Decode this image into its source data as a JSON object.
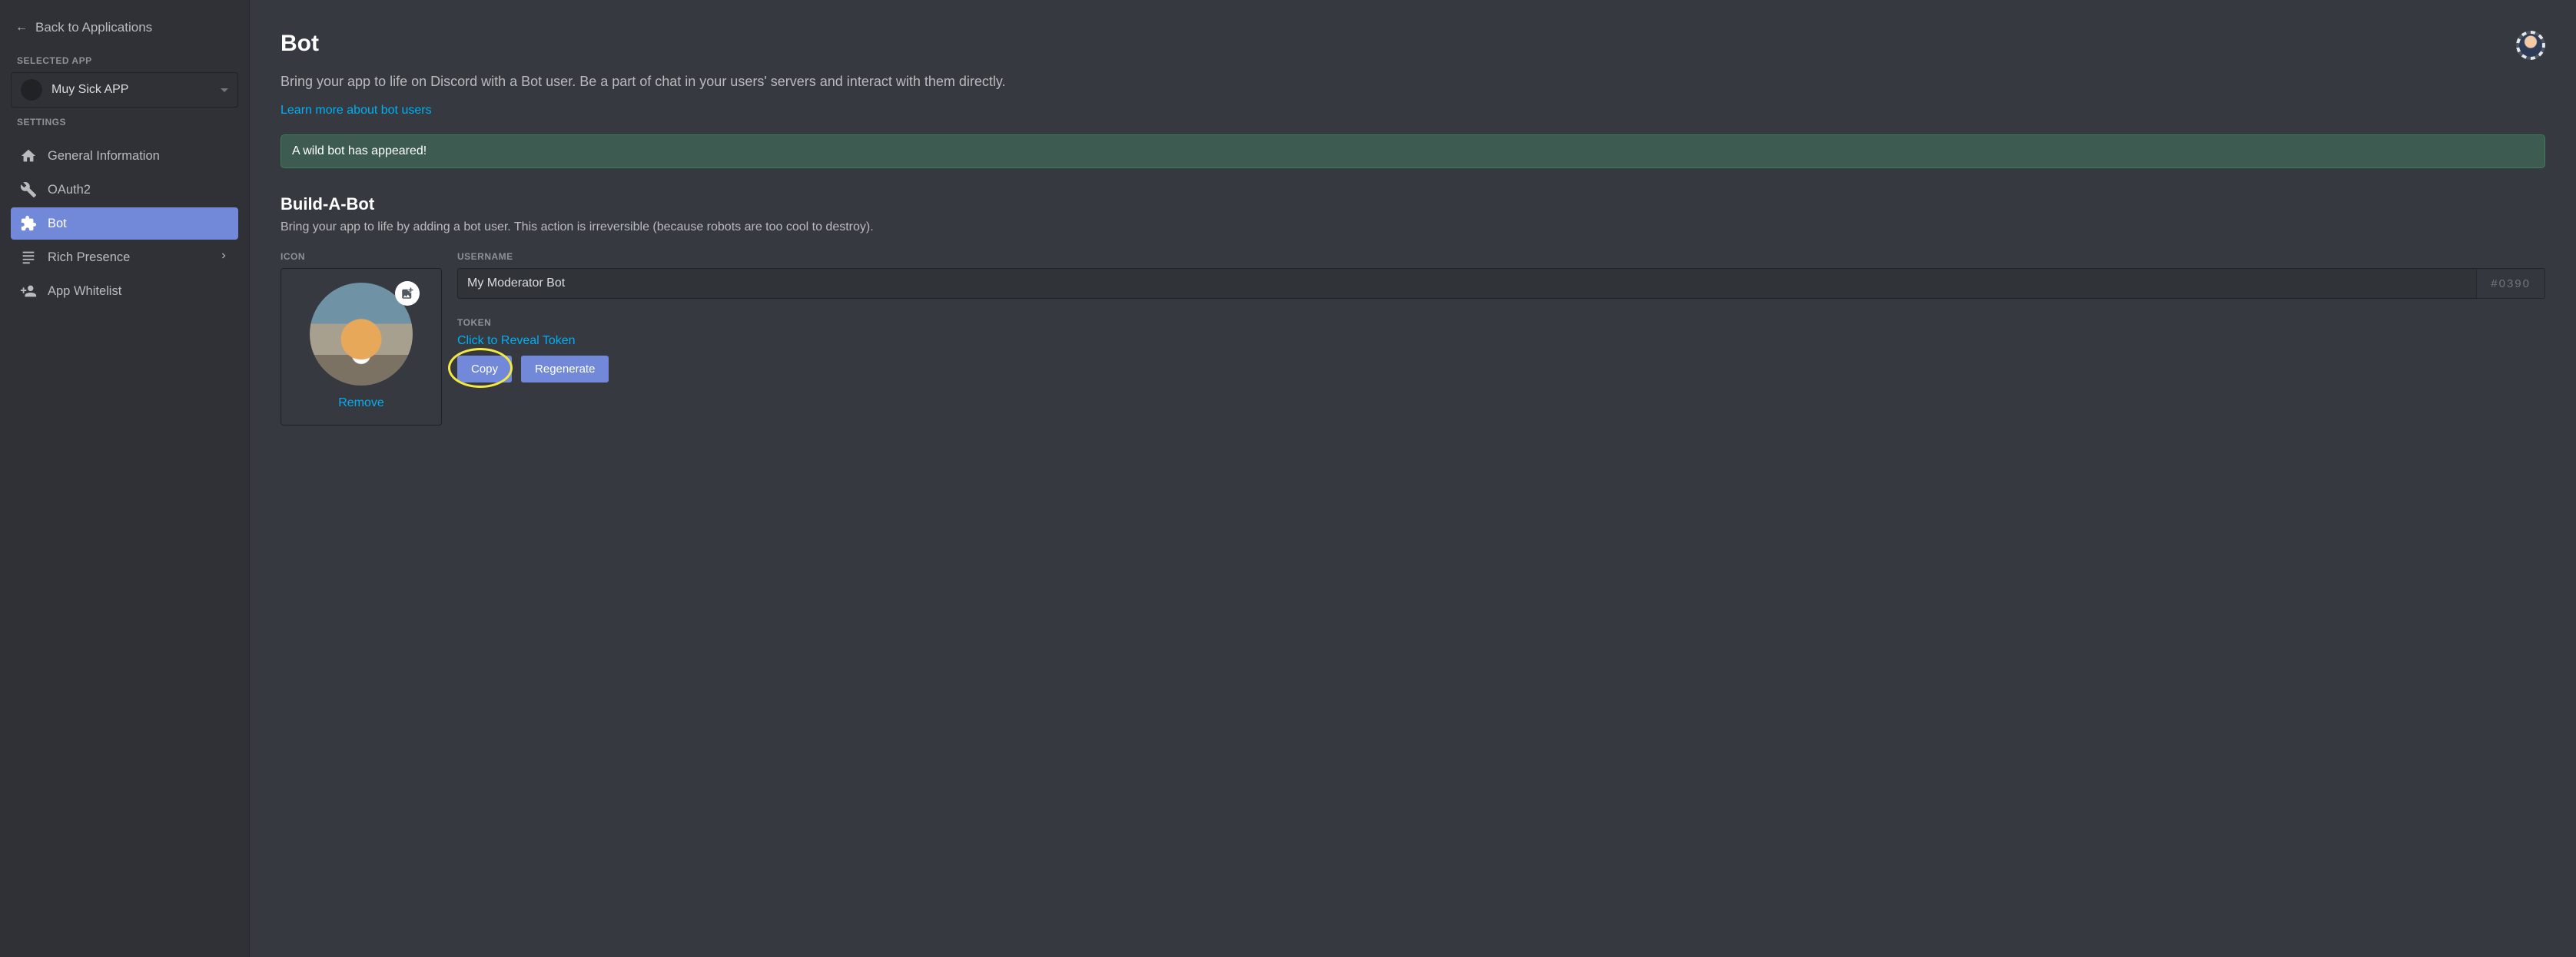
{
  "sidebar": {
    "back_label": "Back to Applications",
    "selected_app_heading": "SELECTED APP",
    "app_name": "Muy Sick APP",
    "settings_heading": "SETTINGS",
    "items": [
      {
        "label": "General Information"
      },
      {
        "label": "OAuth2"
      },
      {
        "label": "Bot"
      },
      {
        "label": "Rich Presence"
      },
      {
        "label": "App Whitelist"
      }
    ]
  },
  "page": {
    "title": "Bot",
    "subtitle": "Bring your app to life on Discord with a Bot user. Be a part of chat in your users' servers and interact with them directly.",
    "learn_more": "Learn more about bot users",
    "alert": "A wild bot has appeared!",
    "build_title": "Build-A-Bot",
    "build_description": "Bring your app to life by adding a bot user. This action is irreversible (because robots are too cool to destroy).",
    "icon_label": "ICON",
    "remove_label": "Remove",
    "username_label": "USERNAME",
    "username_value": "My Moderator Bot",
    "discriminator": "#0390",
    "token_label": "TOKEN",
    "reveal_label": "Click to Reveal Token",
    "copy_label": "Copy",
    "regenerate_label": "Regenerate"
  }
}
